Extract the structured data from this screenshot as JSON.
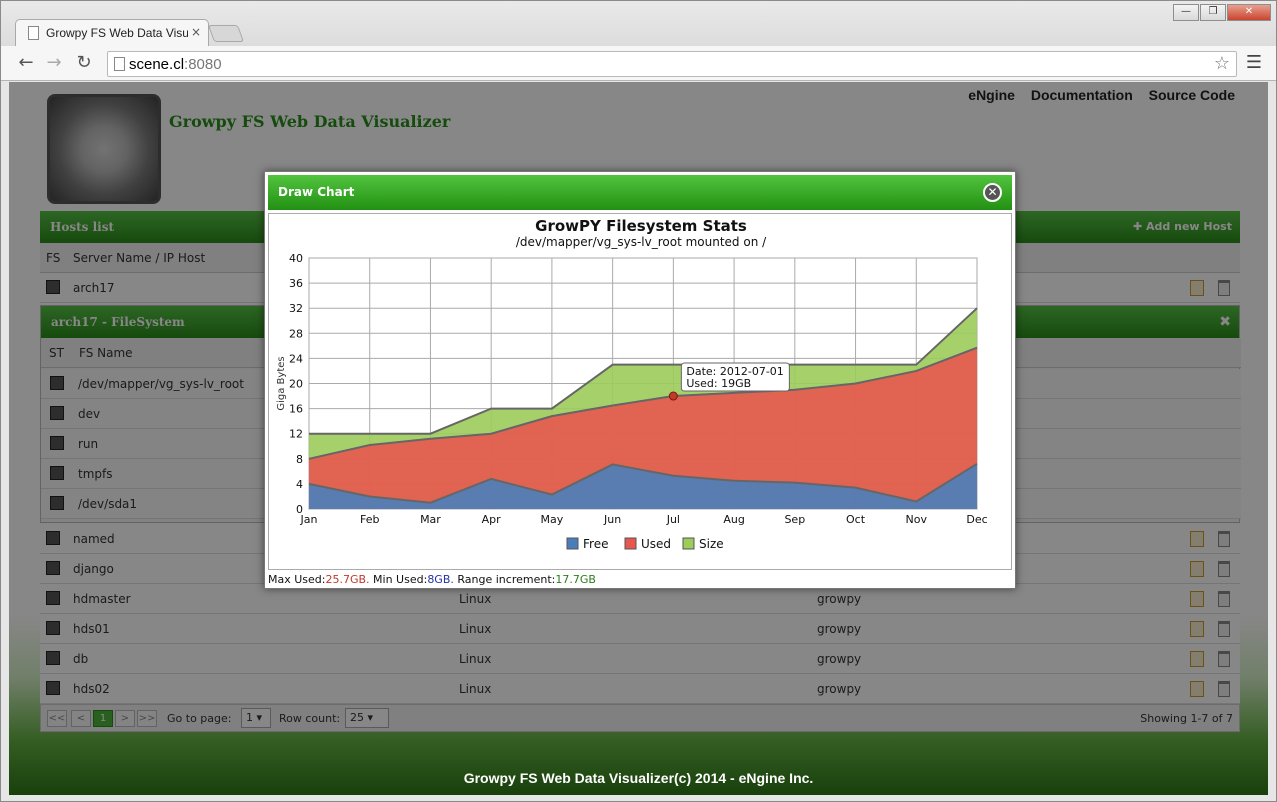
{
  "browser": {
    "tab_title": "Growpy FS Web Data Visu",
    "tab_close": "×",
    "url_host": "scene.cl",
    "url_port": ":8080",
    "win_min": "—",
    "win_max": "❐",
    "win_close": "✕"
  },
  "header": {
    "title": "Growpy FS Web Data Visualizer",
    "nav": [
      "eNgine",
      "Documentation",
      "Source Code"
    ]
  },
  "hosts_panel": {
    "title": "Hosts list",
    "add_label": "✚ Add new Host",
    "col_fs": "FS",
    "col_name": "Server Name / IP Host",
    "rows": [
      {
        "name": "arch17",
        "os": "",
        "user": ""
      },
      {
        "name": "named",
        "os": "",
        "user": ""
      },
      {
        "name": "django",
        "os": "",
        "user": ""
      },
      {
        "name": "hdmaster",
        "os": "Linux",
        "user": "growpy"
      },
      {
        "name": "hds01",
        "os": "Linux",
        "user": "growpy"
      },
      {
        "name": "db",
        "os": "Linux",
        "user": "growpy"
      },
      {
        "name": "hds02",
        "os": "Linux",
        "user": "growpy"
      }
    ]
  },
  "fs_panel": {
    "title": "arch17 - FileSystem",
    "col_st": "ST",
    "col_name": "FS Name",
    "rows": [
      "/dev/mapper/vg_sys-lv_root",
      "dev",
      "run",
      "tmpfs",
      "/dev/sda1"
    ]
  },
  "pager": {
    "first": "<<",
    "prev": "<",
    "page": "1",
    "next": ">",
    "last": ">>",
    "goto_label": "Go to page:",
    "goto_value": "1",
    "rowcount_label": "Row count:",
    "rowcount_value": "25",
    "showing": "Showing 1-7 of 7"
  },
  "footer": "Growpy FS Web Data Visualizer(c) 2014 - eNgine Inc.",
  "dialog": {
    "title": "Draw Chart",
    "close": "✕",
    "stats_max_label": "Max Used:",
    "stats_max": "25.7GB.",
    "stats_min_label": "Min Used:",
    "stats_min": "8GB.",
    "stats_range_label": "Range increment:",
    "stats_range": "17.7GB"
  },
  "tooltip": {
    "date": "Date: 2012-07-01",
    "used": "Used: 19GB"
  },
  "chart_data": {
    "type": "area",
    "title": "GrowPY Filesystem Stats",
    "subtitle": "/dev/mapper/vg_sys-lv_root mounted on /",
    "ylabel": "Giga Bytes",
    "xlabel": "",
    "ylim": [
      0,
      40
    ],
    "yticks": [
      0,
      4,
      8,
      12,
      16,
      20,
      24,
      28,
      32,
      36,
      40
    ],
    "categories": [
      "Jan",
      "Feb",
      "Mar",
      "Apr",
      "May",
      "Jun",
      "Jul",
      "Aug",
      "Sep",
      "Oct",
      "Nov",
      "Dec"
    ],
    "grid": true,
    "legend": "bottom",
    "series": [
      {
        "name": "Free",
        "color": "#4a7ebb",
        "values": [
          4,
          2,
          1,
          4.8,
          2.3,
          7.1,
          5.3,
          4.5,
          4.2,
          3.4,
          1.2,
          7.2
        ]
      },
      {
        "name": "Used",
        "color": "#e8574f",
        "values": [
          8,
          10.2,
          11.2,
          12,
          14.8,
          16.5,
          18,
          18.5,
          19,
          20,
          22,
          25.7
        ]
      },
      {
        "name": "Size",
        "color": "#9ccc5a",
        "values": [
          12,
          12,
          12,
          16,
          16,
          23,
          23,
          23,
          23,
          23,
          23,
          32
        ]
      }
    ]
  }
}
